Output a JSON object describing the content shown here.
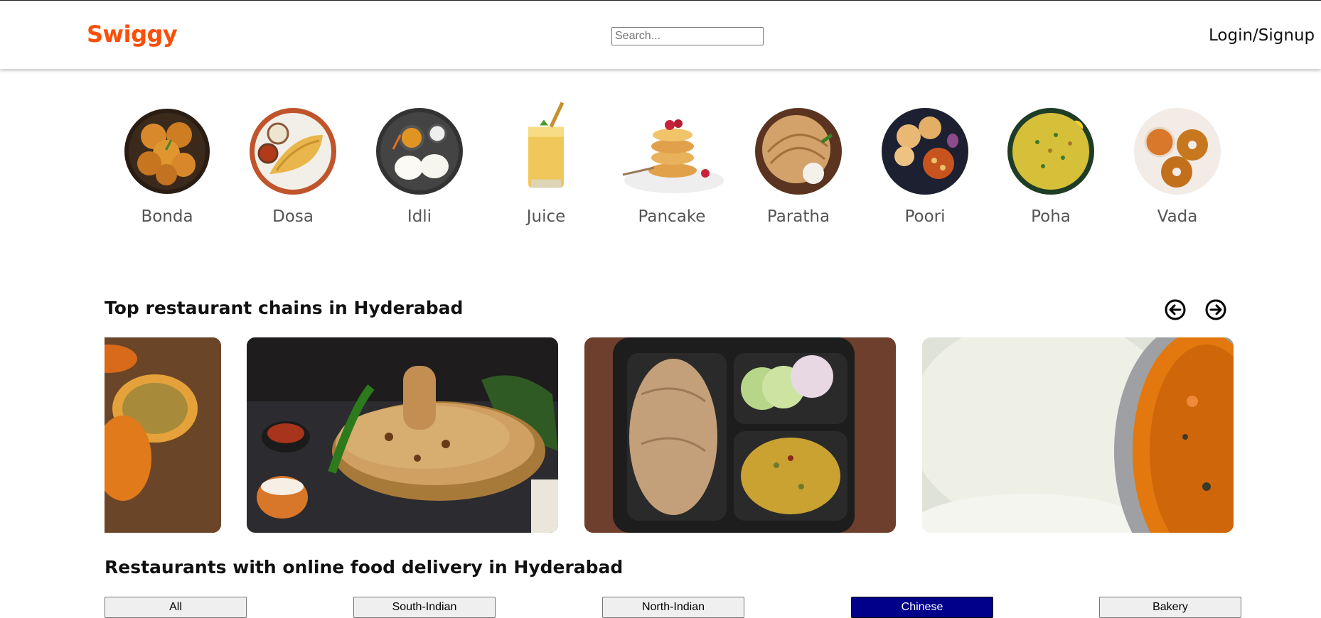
{
  "header": {
    "logo": "Swiggy",
    "search_placeholder": "Search...",
    "login_label": "Login/Signup"
  },
  "categories": [
    {
      "label": "Bonda",
      "icon": "bonda-image"
    },
    {
      "label": "Dosa",
      "icon": "dosa-image"
    },
    {
      "label": "Idli",
      "icon": "idli-image"
    },
    {
      "label": "Juice",
      "icon": "juice-image"
    },
    {
      "label": "Pancake",
      "icon": "pancake-image"
    },
    {
      "label": "Paratha",
      "icon": "paratha-image"
    },
    {
      "label": "Poori",
      "icon": "poori-image"
    },
    {
      "label": "Poha",
      "icon": "poha-image"
    },
    {
      "label": "Vada",
      "icon": "vada-image"
    }
  ],
  "top_chains": {
    "title": "Top restaurant chains in Hyderabad",
    "prev_icon": "arrow-left-circle-icon",
    "next_icon": "arrow-right-circle-icon"
  },
  "online_delivery": {
    "title": "Restaurants with online food delivery in Hyderabad",
    "filters": [
      "All",
      "South-Indian",
      "North-Indian",
      "Chinese",
      "Bakery"
    ],
    "active_filter": "Chinese"
  },
  "colors": {
    "brand": "#fc4f08",
    "active_filter_bg": "#00008b"
  }
}
